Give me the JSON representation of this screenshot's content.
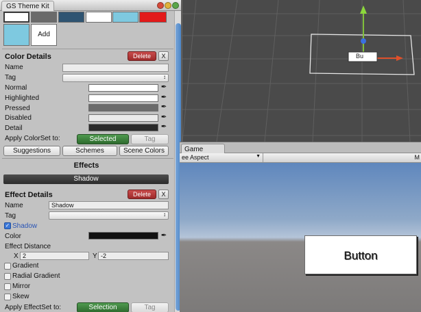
{
  "window": {
    "title": "GS Theme Kit",
    "buttons": [
      "close",
      "minimize",
      "zoom"
    ]
  },
  "swatches": {
    "colors": [
      "#ffffff",
      "#6a6a6a",
      "#2f5472",
      "#ffffff",
      "#7ec9e0",
      "#e21a1a"
    ],
    "selected_color": "#7ec9e0",
    "add_label": "Add"
  },
  "color_details": {
    "header": "Color Details",
    "delete_label": "Delete",
    "close_label": "X",
    "name_label": "Name",
    "name_value": "",
    "tag_label": "Tag",
    "tag_value": "",
    "rows": [
      {
        "label": "Normal",
        "color": "#ffffff"
      },
      {
        "label": "Highlighted",
        "color": "#ffffff"
      },
      {
        "label": "Pressed",
        "color": "#6b6b6b"
      },
      {
        "label": "Disabled",
        "color": "#ebebeb"
      },
      {
        "label": "Detail",
        "color": "#2a2a2a"
      }
    ],
    "apply_label": "Apply ColorSet to:",
    "selected_label": "Selected",
    "tag_button_label": "Tag"
  },
  "bottom_buttons": {
    "suggestions": "Suggestions",
    "schemes": "Schemes",
    "scene_colors": "Scene Colors"
  },
  "effects": {
    "title": "Effects",
    "shadow_bar_label": "Shadow"
  },
  "effect_details": {
    "header": "Effect Details",
    "delete_label": "Delete",
    "close_label": "X",
    "name_label": "Name",
    "name_value": "Shadow",
    "tag_label": "Tag",
    "tag_value": "",
    "shadow_checkbox_label": "Shadow",
    "shadow_checked": true,
    "color_label": "Color",
    "shadow_color": "#111111",
    "distance_label": "Effect Distance",
    "x_label": "X",
    "x_value": "2",
    "y_label": "Y",
    "y_value": "-2",
    "gradient_label": "Gradient",
    "radial_gradient_label": "Radial Gradient",
    "mirror_label": "Mirror",
    "skew_label": "Skew",
    "apply_label": "Apply EffectSet to:",
    "selection_label": "Selection",
    "tag_button_label": "Tag"
  },
  "game": {
    "tab_label": "Game",
    "aspect_label": "ee Aspect",
    "toolbar_right": "M",
    "button_text": "Button"
  },
  "scene": {
    "object_label": "Bu"
  },
  "colors": {
    "delete_red": "#b03838",
    "apply_green": "#3a7d3a",
    "panel_bg": "#c2c2c2"
  }
}
